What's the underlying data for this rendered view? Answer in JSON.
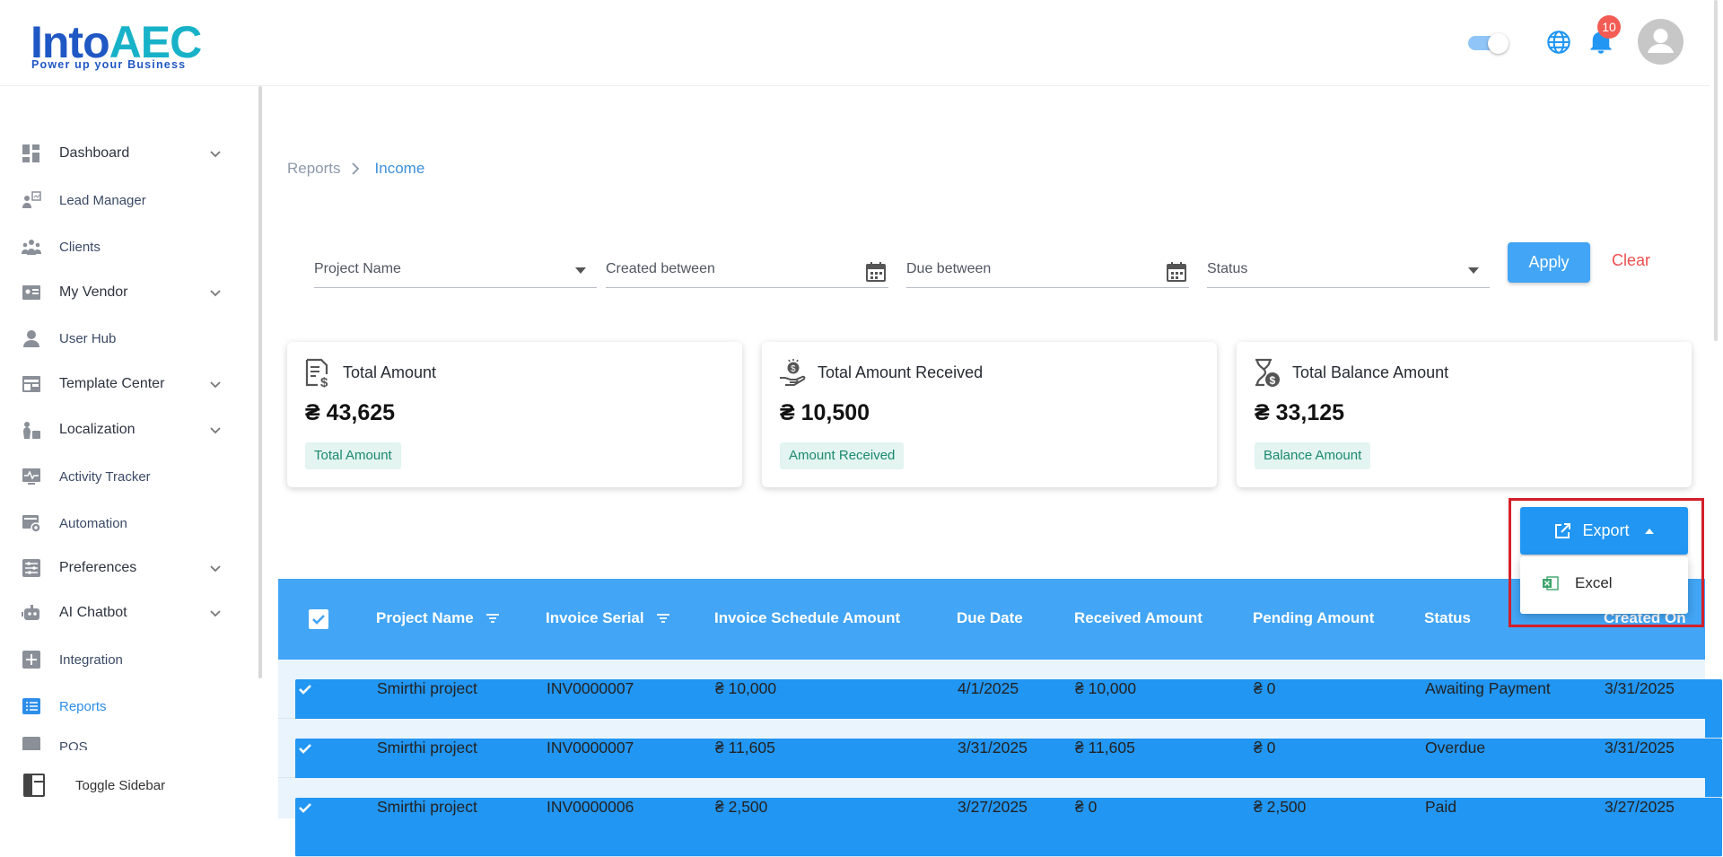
{
  "brand": {
    "logo_primary": "Into",
    "logo_accent": "AEC",
    "tagline": "Power up your Business"
  },
  "header": {
    "notification_count": "10",
    "colors": {
      "accent": "#2196f3",
      "badge": "#f25c54"
    }
  },
  "sidebar": {
    "items": [
      {
        "label": "Dashboard",
        "icon": "dashboard-icon",
        "expandable": true
      },
      {
        "label": "Lead Manager",
        "icon": "lead-manager-icon",
        "expandable": false
      },
      {
        "label": "Clients",
        "icon": "clients-icon",
        "expandable": false
      },
      {
        "label": "My Vendor",
        "icon": "vendor-icon",
        "expandable": true
      },
      {
        "label": "User Hub",
        "icon": "user-icon",
        "expandable": false
      },
      {
        "label": "Template Center",
        "icon": "template-icon",
        "expandable": true
      },
      {
        "label": "Localization",
        "icon": "localization-icon",
        "expandable": true
      },
      {
        "label": "Activity Tracker",
        "icon": "activity-icon",
        "expandable": false
      },
      {
        "label": "Automation",
        "icon": "automation-icon",
        "expandable": false
      },
      {
        "label": "Preferences",
        "icon": "preferences-icon",
        "expandable": true
      },
      {
        "label": "AI Chatbot",
        "icon": "chatbot-icon",
        "expandable": true
      },
      {
        "label": "Integration",
        "icon": "integration-icon",
        "expandable": false
      },
      {
        "label": "Reports",
        "icon": "reports-icon",
        "expandable": false,
        "active": true
      },
      {
        "label": "POS",
        "icon": "pos-icon",
        "expandable": false
      }
    ],
    "toggle_label": "Toggle Sidebar"
  },
  "breadcrumb": {
    "parent": "Reports",
    "current": "Income"
  },
  "filters": {
    "project_name": "Project Name",
    "created_between": "Created between",
    "due_between": "Due between",
    "status": "Status",
    "apply_label": "Apply",
    "clear_label": "Clear"
  },
  "cards": [
    {
      "title": "Total Amount",
      "value": "₴ 43,625",
      "chip": "Total Amount",
      "icon": "invoice-dollar-icon"
    },
    {
      "title": "Total Amount Received",
      "value": "₴ 10,500",
      "chip": "Amount Received",
      "icon": "hand-money-icon"
    },
    {
      "title": "Total Balance Amount",
      "value": "₴ 33,125",
      "chip": "Balance Amount",
      "icon": "hourglass-dollar-icon"
    }
  ],
  "export": {
    "label": "Export",
    "menu": [
      "Excel"
    ]
  },
  "table": {
    "columns": [
      "Project Name",
      "Invoice Serial",
      "Invoice Schedule Amount",
      "Due Date",
      "Received Amount",
      "Pending Amount",
      "Status",
      "Created On"
    ],
    "rows": [
      {
        "project": "Smirthi project",
        "serial": "INV0000007",
        "schedule": "₴ 10,000",
        "due": "4/1/2025",
        "received": "₴ 10,000",
        "pending": "₴ 0",
        "status": "Awaiting Payment",
        "created": "3/31/2025"
      },
      {
        "project": "Smirthi project",
        "serial": "INV0000007",
        "schedule": "₴ 11,605",
        "due": "3/31/2025",
        "received": "₴ 11,605",
        "pending": "₴ 0",
        "status": "Overdue",
        "created": "3/31/2025"
      },
      {
        "project": "Smirthi project",
        "serial": "INV0000006",
        "schedule": "₴ 2,500",
        "due": "3/27/2025",
        "received": "₴ 0",
        "pending": "₴ 2,500",
        "status": "Paid",
        "created": "3/27/2025"
      }
    ]
  }
}
